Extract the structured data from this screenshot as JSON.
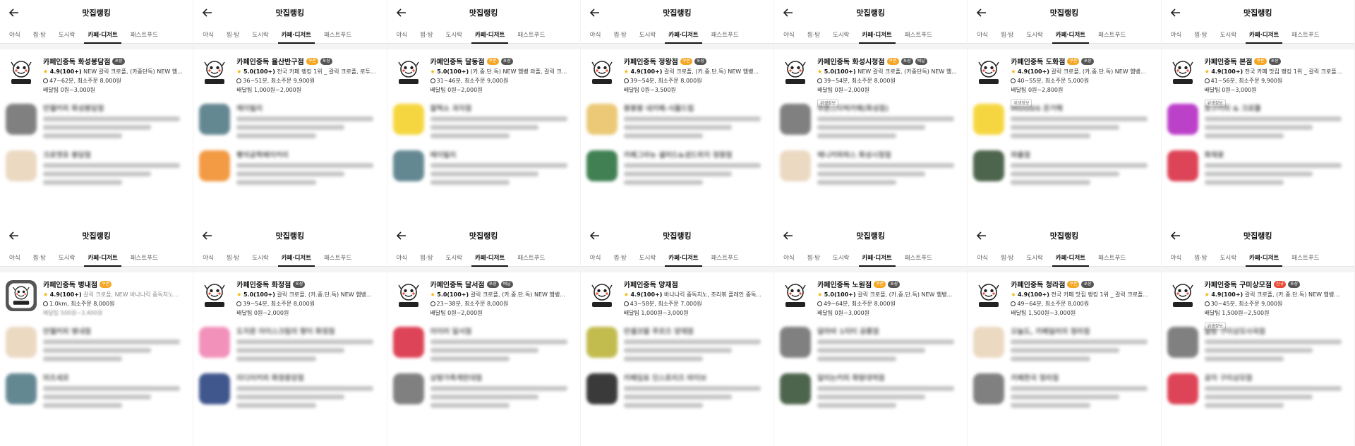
{
  "common": {
    "page_title": "맛집랭킹",
    "tabs": [
      "야식",
      "찜·탕",
      "도시락",
      "카페·디저트",
      "패스트푸드"
    ],
    "active_tab": 3,
    "delivery_tag": "위생정보"
  },
  "colors": {
    "star": "#f5b400",
    "badge_orange": "#f5a623",
    "badge_dark": "#555555",
    "badge_red": "#e94b35"
  },
  "panels": [
    {
      "shop": {
        "name": "카페인중독 화성봉담점",
        "badges": [
          {
            "text": "포장",
            "color": "dark"
          }
        ],
        "rating": "4.9",
        "reviews": "(100+)",
        "desc": "NEW 갈릭 크로플, (카중단독) NEW 햄...",
        "time": "47~62분",
        "min_order": "최소주문 8,000원",
        "tip": "배달팁 0원~3,000원",
        "tag": ""
      },
      "blurred": [
        {
          "name": "만델커피 화성봉담점",
          "logo": "gray"
        },
        {
          "name": "크로엣쥬 봉담점",
          "logo": "pastry"
        }
      ]
    },
    {
      "shop": {
        "name": "카페인중독 율산반구점",
        "badges": [
          {
            "text": "쿠폰",
            "color": "orange"
          },
          {
            "text": "포장",
            "color": "dark"
          }
        ],
        "rating": "5.0",
        "reviews": "(100+)",
        "desc": "전국 카페 랭킹 1위 _ 갈릭 크로플, 로투...",
        "time": "36~51분",
        "min_order": "최소주문 9,900원",
        "tip": "배달팁 1,000원~2,000원",
        "tag": ""
      },
      "blurred": [
        {
          "name": "메이빌리",
          "logo": "teal"
        },
        {
          "name": "빵의공학배이커리",
          "logo": "orange"
        }
      ]
    },
    {
      "shop": {
        "name": "카페인중독 달동점",
        "badges": [
          {
            "text": "쿠폰",
            "color": "orange"
          },
          {
            "text": "포장",
            "color": "dark"
          }
        ],
        "rating": "5.0",
        "reviews": "(100+)",
        "desc": "(카.중.단.독) NEW 햄뱅 와플, 갈릭 크...",
        "time": "31~46분",
        "min_order": "최소주문 9,000원",
        "tip": "배달팁 0원~2,000원",
        "tag": ""
      },
      "blurred": [
        {
          "name": "찰떡소 과자점",
          "logo": "yellow"
        },
        {
          "name": "메이빌리",
          "logo": "teal"
        }
      ]
    },
    {
      "shop": {
        "name": "카페인중독 정왕점",
        "badges": [
          {
            "text": "쿠폰",
            "color": "orange"
          },
          {
            "text": "포장",
            "color": "dark"
          }
        ],
        "rating": "4.9",
        "reviews": "(100+)",
        "desc": "갈릭 크로플, (카.중.단.독) NEW 햄뱅...",
        "time": "39~54분",
        "min_order": "최소주문 8,000원",
        "tip": "배달팁 0원~3,500원",
        "tag": ""
      },
      "blurred": [
        {
          "name": "봉봉봉 네카페-식물드립",
          "logo": "cake"
        },
        {
          "name": "카페그라뉴 샐러드&샌드위치 정왕점",
          "logo": "green"
        }
      ]
    },
    {
      "shop": {
        "name": "카페인중독 화성시청점",
        "badges": [
          {
            "text": "쿠폰",
            "color": "orange"
          },
          {
            "text": "포장",
            "color": "dark"
          },
          {
            "text": "배달",
            "color": "dark"
          }
        ],
        "rating": "5.0",
        "reviews": "(100+)",
        "desc": "NEW 갈릭 크로플, (카중단독) NEW 햄...",
        "time": "39~54분",
        "min_order": "최소주문 8,000원",
        "tip": "배달팁 0원~2,000원",
        "tag": "위생정보"
      },
      "blurred": [
        {
          "name": "푸른스타벅카페(화성점)",
          "logo": "gray"
        },
        {
          "name": "메니커파파스 화성시청점",
          "logo": "pastry"
        }
      ]
    },
    {
      "shop": {
        "name": "카페인중독 도화점",
        "badges": [
          {
            "text": "쿠폰",
            "color": "orange"
          },
          {
            "text": "포장",
            "color": "dark"
          }
        ],
        "rating": "4.9",
        "reviews": "(100+)",
        "desc": "갈릭 크로플, (카.중.단.독) NEW 햄뱅...",
        "time": "40~55분",
        "min_order": "최소주문 5,000원",
        "tip": "배달팁 0원~2,800원",
        "tag": "위생정보"
      },
      "blurred": [
        {
          "name": "MOODS 온거해",
          "logo": "yellow"
        },
        {
          "name": "파출점",
          "logo": "darkgreen"
        }
      ]
    },
    {
      "shop": {
        "name": "카페인중독 본점",
        "badges": [
          {
            "text": "쿠폰",
            "color": "orange"
          },
          {
            "text": "포장",
            "color": "dark"
          }
        ],
        "rating": "4.9",
        "reviews": "(100+)",
        "desc": "전국 카페 맛집 랭킹 1위 _ 갈릭 크로플...",
        "time": "41~56분",
        "min_order": "최소주문 9,900원",
        "tip": "배달팁 0원~3,000원",
        "tag": "위생정보"
      },
      "blurred": [
        {
          "name": "호구커피 & 크로플",
          "logo": "purple"
        },
        {
          "name": "화채꽃",
          "logo": "red"
        }
      ]
    },
    {
      "shop": {
        "name": "카페인중독 병내점",
        "badges": [
          {
            "text": "쿠폰",
            "color": "orange"
          }
        ],
        "rating": "4.9",
        "reviews": "(100+)",
        "desc": "갈릭 크로플, NEW 바나나킥 중독치노...",
        "time": "1.0km",
        "min_order": "최소주문 8,000원",
        "tip": "배달팁 500원~3,400원",
        "tag": "",
        "faded": true
      },
      "blurred": [
        {
          "name": "만델커피 병내점",
          "logo": "pastry"
        },
        {
          "name": "마츠세르",
          "logo": "teal"
        }
      ]
    },
    {
      "shop": {
        "name": "카페인중독 화정점",
        "badges": [
          {
            "text": "포장",
            "color": "dark"
          }
        ],
        "rating": "5.0",
        "reviews": "(100+)",
        "desc": "갈릭 크로플, (카.중.단.독) NEW 햄뱅...",
        "time": "39~54분",
        "min_order": "최소주문 8,000원",
        "tip": "배달팁 0원~2,000원",
        "tag": ""
      },
      "blurred": [
        {
          "name": "도치퀸 아이스크림의 향이 화정점",
          "logo": "pink"
        },
        {
          "name": "미디어커피 화정중앙점",
          "logo": "navy"
        }
      ]
    },
    {
      "shop": {
        "name": "카페인중독 달서점",
        "badges": [
          {
            "text": "포장",
            "color": "dark"
          },
          {
            "text": "배달",
            "color": "dark"
          }
        ],
        "rating": "5.0",
        "reviews": "(100+)",
        "desc": "갈릭 크로플, (카.중.단.독) NEW 햄뱅...",
        "time": "23~38분",
        "min_order": "최소주문 8,000원",
        "tip": "배달팁 0원~2,000원",
        "tag": ""
      },
      "blurred": [
        {
          "name": "아이러 달서점",
          "logo": "red"
        },
        {
          "name": "상량가족계란대점",
          "logo": "gray"
        }
      ]
    },
    {
      "shop": {
        "name": "카페인중독 양재점",
        "badges": [],
        "rating": "4.9",
        "reviews": "(100+)",
        "desc": "바나나킥 중독치노, 조리볶 플레인 중독...",
        "time": "43~58분",
        "min_order": "최소주문 7,000원",
        "tip": "배달팁 1,000원~3,000원",
        "tag": ""
      },
      "blurred": [
        {
          "name": "만셀코팔 푸르즈 양재점",
          "logo": "olive"
        },
        {
          "name": "카페임표 인스토리즈 바이브",
          "logo": "black"
        }
      ]
    },
    {
      "shop": {
        "name": "카페인중독 노원점",
        "badges": [
          {
            "text": "쿠폰",
            "color": "orange"
          },
          {
            "text": "포장",
            "color": "dark"
          }
        ],
        "rating": "5.0",
        "reviews": "(100+)",
        "desc": "갈릭 크로플, (카.중.단.독) NEW 햄뱅...",
        "time": "49~64분",
        "min_order": "최소주문 8,000원",
        "tip": "배달팁 0원~3,000원",
        "tag": ""
      },
      "blurred": [
        {
          "name": "달마바 1리터 공릉점",
          "logo": "gray"
        },
        {
          "name": "달리는커피 화랑대역점",
          "logo": "darkgreen"
        }
      ]
    },
    {
      "shop": {
        "name": "카페인중독 청라점",
        "badges": [
          {
            "text": "쿠폰",
            "color": "orange"
          },
          {
            "text": "포장",
            "color": "dark"
          }
        ],
        "rating": "4.9",
        "reviews": "(100+)",
        "desc": "전국 카페 맛집 랭킹 1위 _ 갈릭 크로플...",
        "time": "49~64분",
        "min_order": "최소주문 8,000원",
        "tip": "배달팁 1,500원~3,000원",
        "tag": ""
      },
      "blurred": [
        {
          "name": "오늘도, 카페일러의 청라점",
          "logo": "pastry"
        },
        {
          "name": "카페한국 청라점",
          "logo": "gray"
        }
      ]
    },
    {
      "shop": {
        "name": "카페인중독 구미상모점",
        "badges": [
          {
            "text": "신규",
            "color": "red"
          },
          {
            "text": "포장",
            "color": "dark"
          }
        ],
        "rating": "4.9",
        "reviews": "(100+)",
        "desc": "갈릭 크로플, (카.중.단.독) NEW 햄뱅...",
        "time": "30~45분",
        "min_order": "최소주문 9,000원",
        "tip": "배달팁 1,500원~2,500원",
        "tag": "위생정보"
      },
      "blurred": [
        {
          "name": "말랑 구미상모사곡점",
          "logo": "gray"
        },
        {
          "name": "공차 구미상모점",
          "logo": "red"
        }
      ]
    }
  ]
}
